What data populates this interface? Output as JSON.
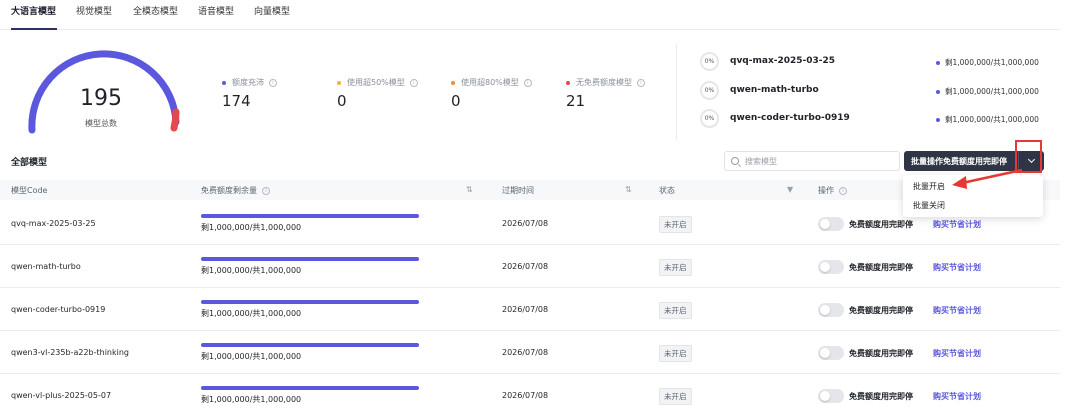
{
  "tabs": [
    {
      "label": "大语言模型",
      "active": true
    },
    {
      "label": "视觉模型",
      "active": false
    },
    {
      "label": "全模态模型",
      "active": false
    },
    {
      "label": "语音模型",
      "active": false
    },
    {
      "label": "向量模型",
      "active": false
    }
  ],
  "gauge": {
    "value": "195",
    "label": "模型总数"
  },
  "stats": [
    {
      "label": "额度充沛",
      "value": "174",
      "color": "#5b58de"
    },
    {
      "label": "使用超50%模型",
      "value": "0",
      "color": "#f5b335"
    },
    {
      "label": "使用超80%模型",
      "value": "0",
      "color": "#f08a3c"
    },
    {
      "label": "无免费额度模型",
      "value": "21",
      "color": "#e5484d"
    }
  ],
  "quota_list": [
    {
      "pct": "0%",
      "name": "qvq-max-2025-03-25",
      "remain": "剩1,000,000/共1,000,000"
    },
    {
      "pct": "0%",
      "name": "qwen-math-turbo",
      "remain": "剩1,000,000/共1,000,000"
    },
    {
      "pct": "0%",
      "name": "qwen-coder-turbo-0919",
      "remain": "剩1,000,000/共1,000,000"
    }
  ],
  "section_title": "全部模型",
  "search": {
    "placeholder": "搜索模型"
  },
  "batch_button": {
    "label": "批量操作免费额度用完即停"
  },
  "dropdown": {
    "items": [
      "批量开启",
      "批量关闭"
    ]
  },
  "table": {
    "headers": {
      "code": "模型Code",
      "quota": "免费额度剩余量",
      "expire": "过期时间",
      "status": "状态",
      "action": "操作"
    },
    "rows": [
      {
        "code": "qvq-max-2025-03-25",
        "remain": "剩1,000,000/共1,000,000",
        "fill": 1.0,
        "expire": "2026/07/08",
        "status": "未开启",
        "action": "免费额度用完即停",
        "link": "购买节省计划"
      },
      {
        "code": "qwen-math-turbo",
        "remain": "剩1,000,000/共1,000,000",
        "fill": 1.0,
        "expire": "2026/07/08",
        "status": "未开启",
        "action": "免费额度用完即停",
        "link": "购买节省计划"
      },
      {
        "code": "qwen-coder-turbo-0919",
        "remain": "剩1,000,000/共1,000,000",
        "fill": 1.0,
        "expire": "2026/07/08",
        "status": "未开启",
        "action": "免费额度用完即停",
        "link": "购买节省计划"
      },
      {
        "code": "qwen3-vl-235b-a22b-thinking",
        "remain": "剩1,000,000/共1,000,000",
        "fill": 1.0,
        "expire": "2026/07/08",
        "status": "未开启",
        "action": "免费额度用完即停",
        "link": "购买节省计划"
      },
      {
        "code": "qwen-vl-plus-2025-05-07",
        "remain": "剩1,000,000/共1,000,000",
        "fill": 1.0,
        "expire": "2026/07/08",
        "status": "未开启",
        "action": "免费额度用完即停",
        "link": "购买节省计划"
      }
    ]
  },
  "colors": {
    "accent": "#5b58de",
    "dark_button": "#2f3545",
    "annotation_red": "#e53935",
    "gauge_end": "#e5484d"
  }
}
